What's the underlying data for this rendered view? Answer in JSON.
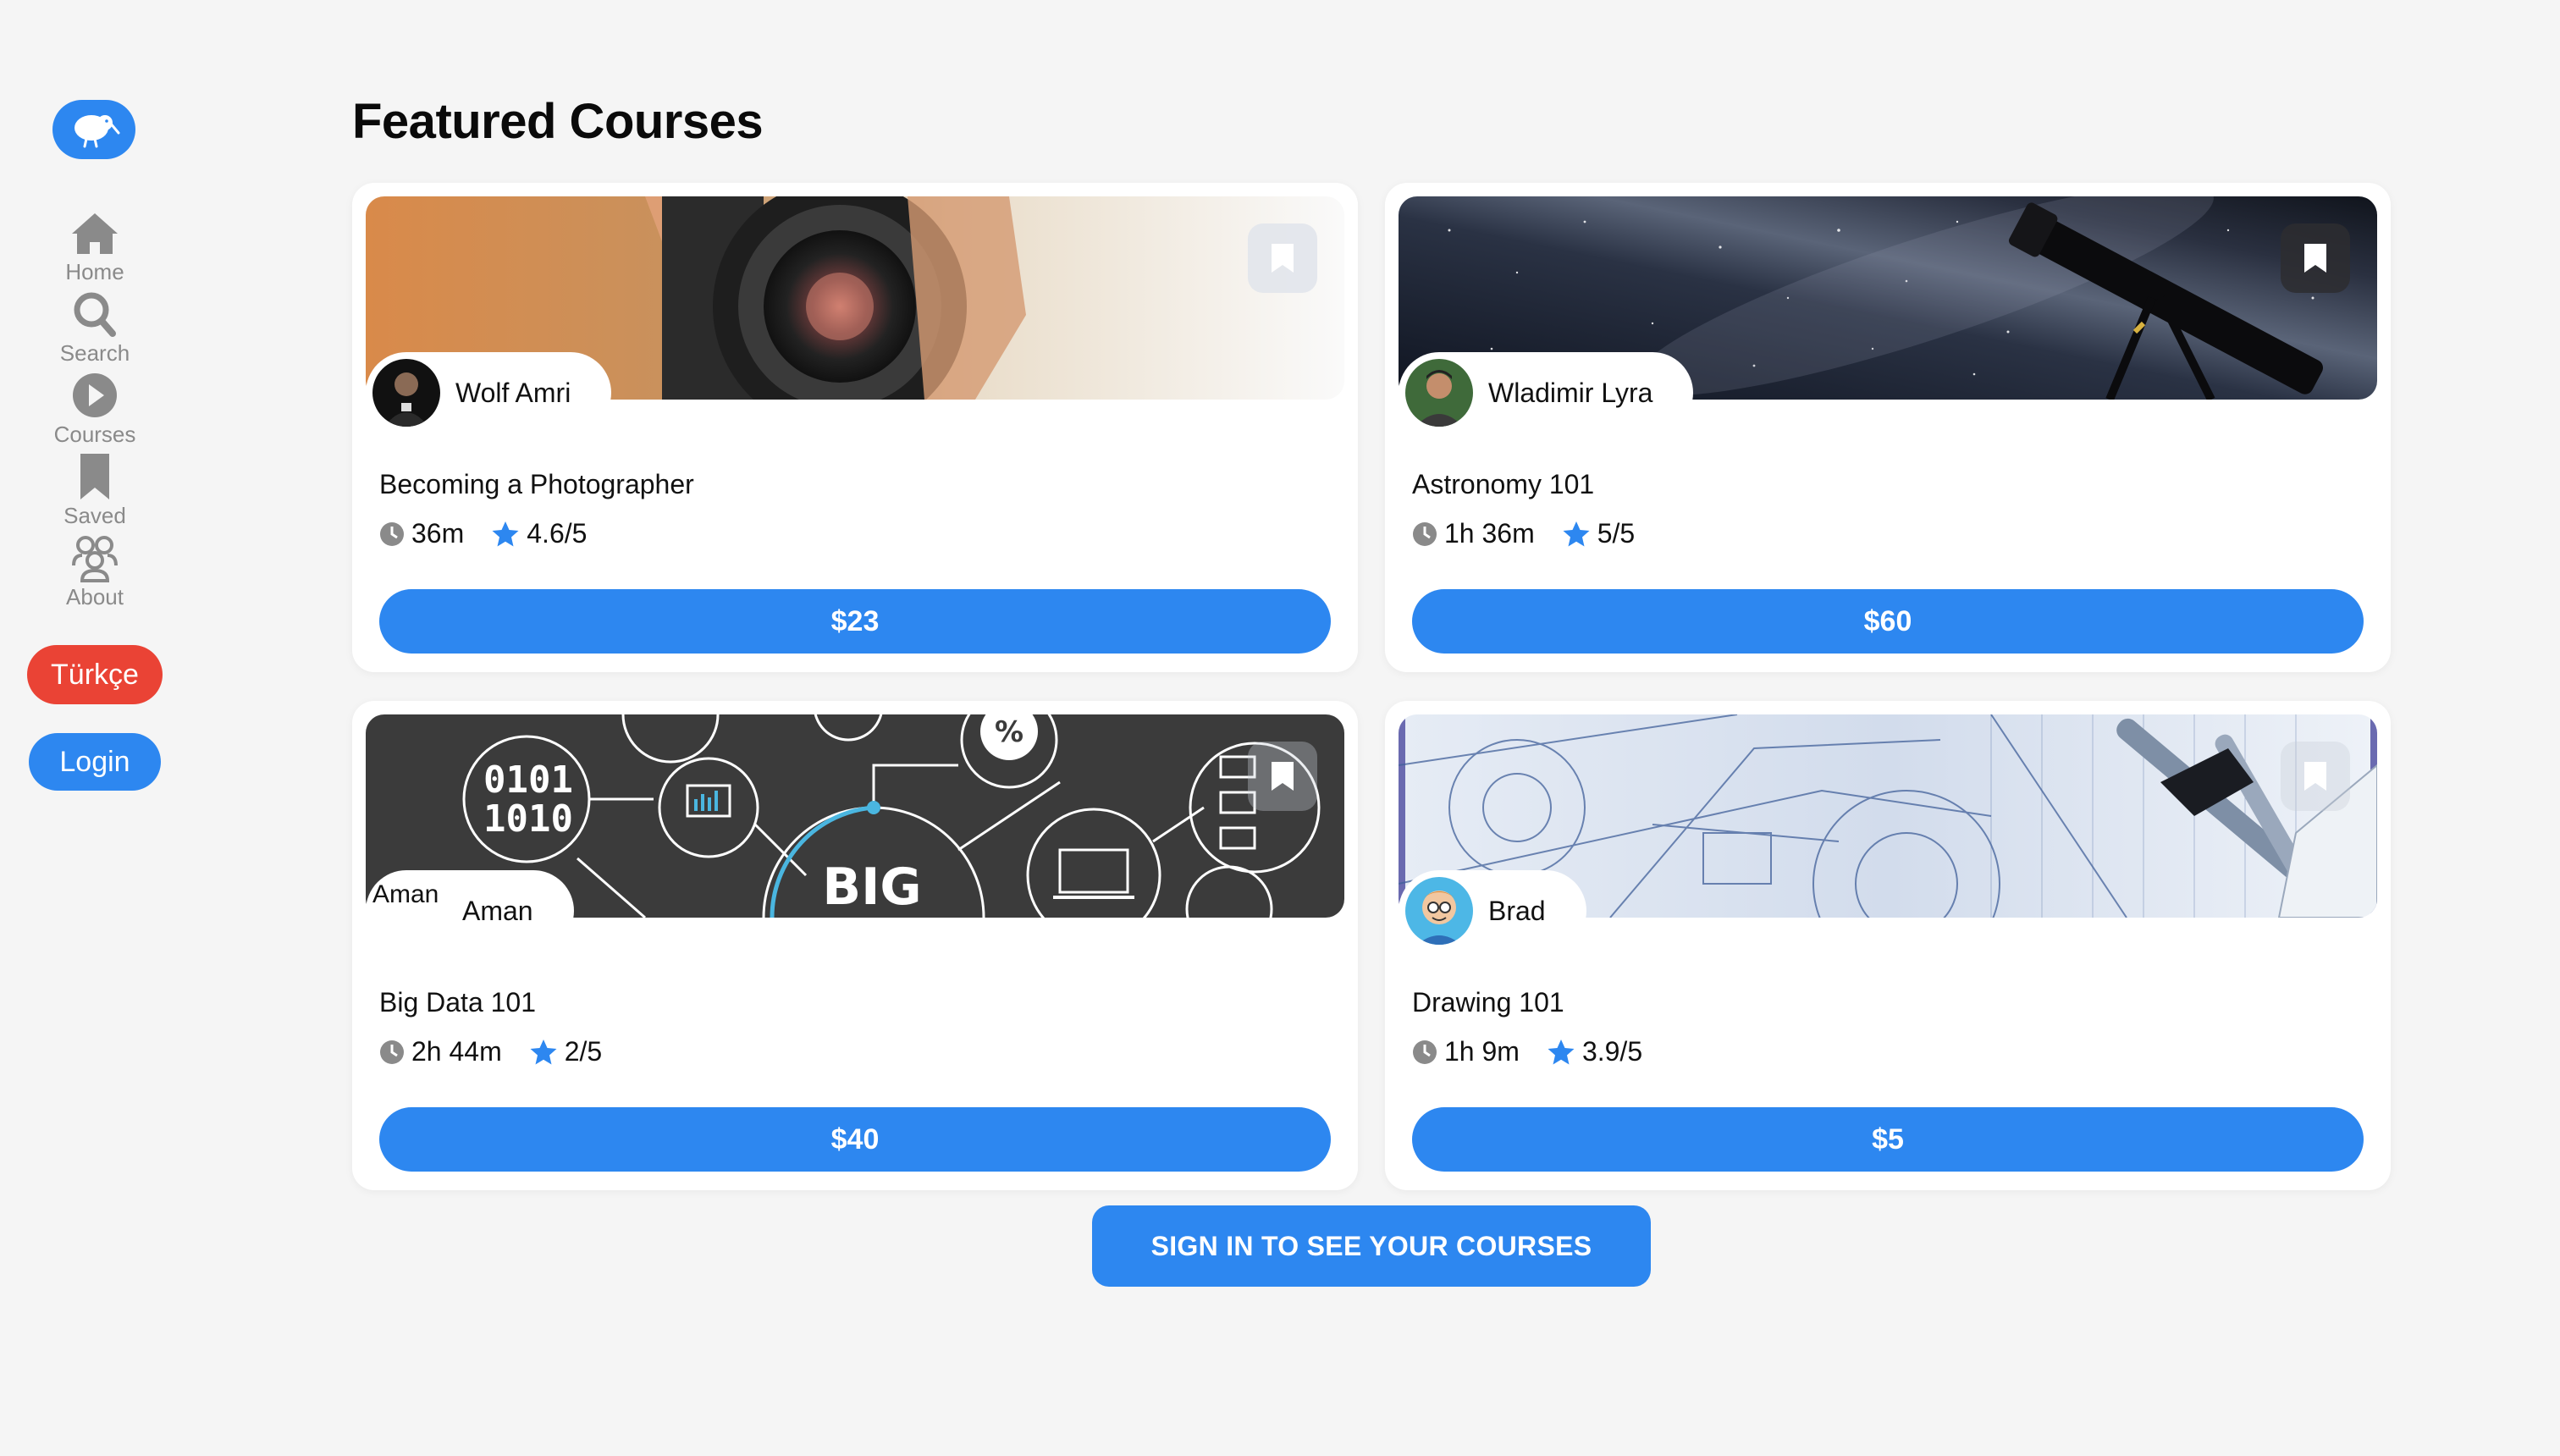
{
  "sidebar": {
    "logo": {
      "icon": "kiwi-bird-icon"
    },
    "nav": [
      {
        "label": "Home",
        "icon": "home-icon"
      },
      {
        "label": "Search",
        "icon": "search-icon"
      },
      {
        "label": "Courses",
        "icon": "play-circle-icon"
      },
      {
        "label": "Saved",
        "icon": "bookmark-icon"
      },
      {
        "label": "About",
        "icon": "users-icon"
      }
    ],
    "language_button": "Türkçe",
    "login_button": "Login"
  },
  "main": {
    "title": "Featured Courses",
    "courses": [
      {
        "author": "Wolf Amri",
        "title": "Becoming a Photographer",
        "duration": "36m",
        "rating": "4.6/5",
        "price": "$23"
      },
      {
        "author": "Wladimir Lyra",
        "title": "Astronomy 101",
        "duration": "1h 36m",
        "rating": "5/5",
        "price": "$60"
      },
      {
        "author": "Aman",
        "avatar_alt": "Aman",
        "title": "Big Data 101",
        "duration": "2h 44m",
        "rating": "2/5",
        "price": "$40"
      },
      {
        "author": "Brad",
        "title": "Drawing 101",
        "duration": "1h 9m",
        "rating": "3.9/5",
        "price": "$5"
      }
    ],
    "cta": "SIGN IN TO SEE YOUR COURSES"
  },
  "colors": {
    "primary": "#2d87f0",
    "danger": "#ea4335",
    "background": "#f5f5f5"
  }
}
